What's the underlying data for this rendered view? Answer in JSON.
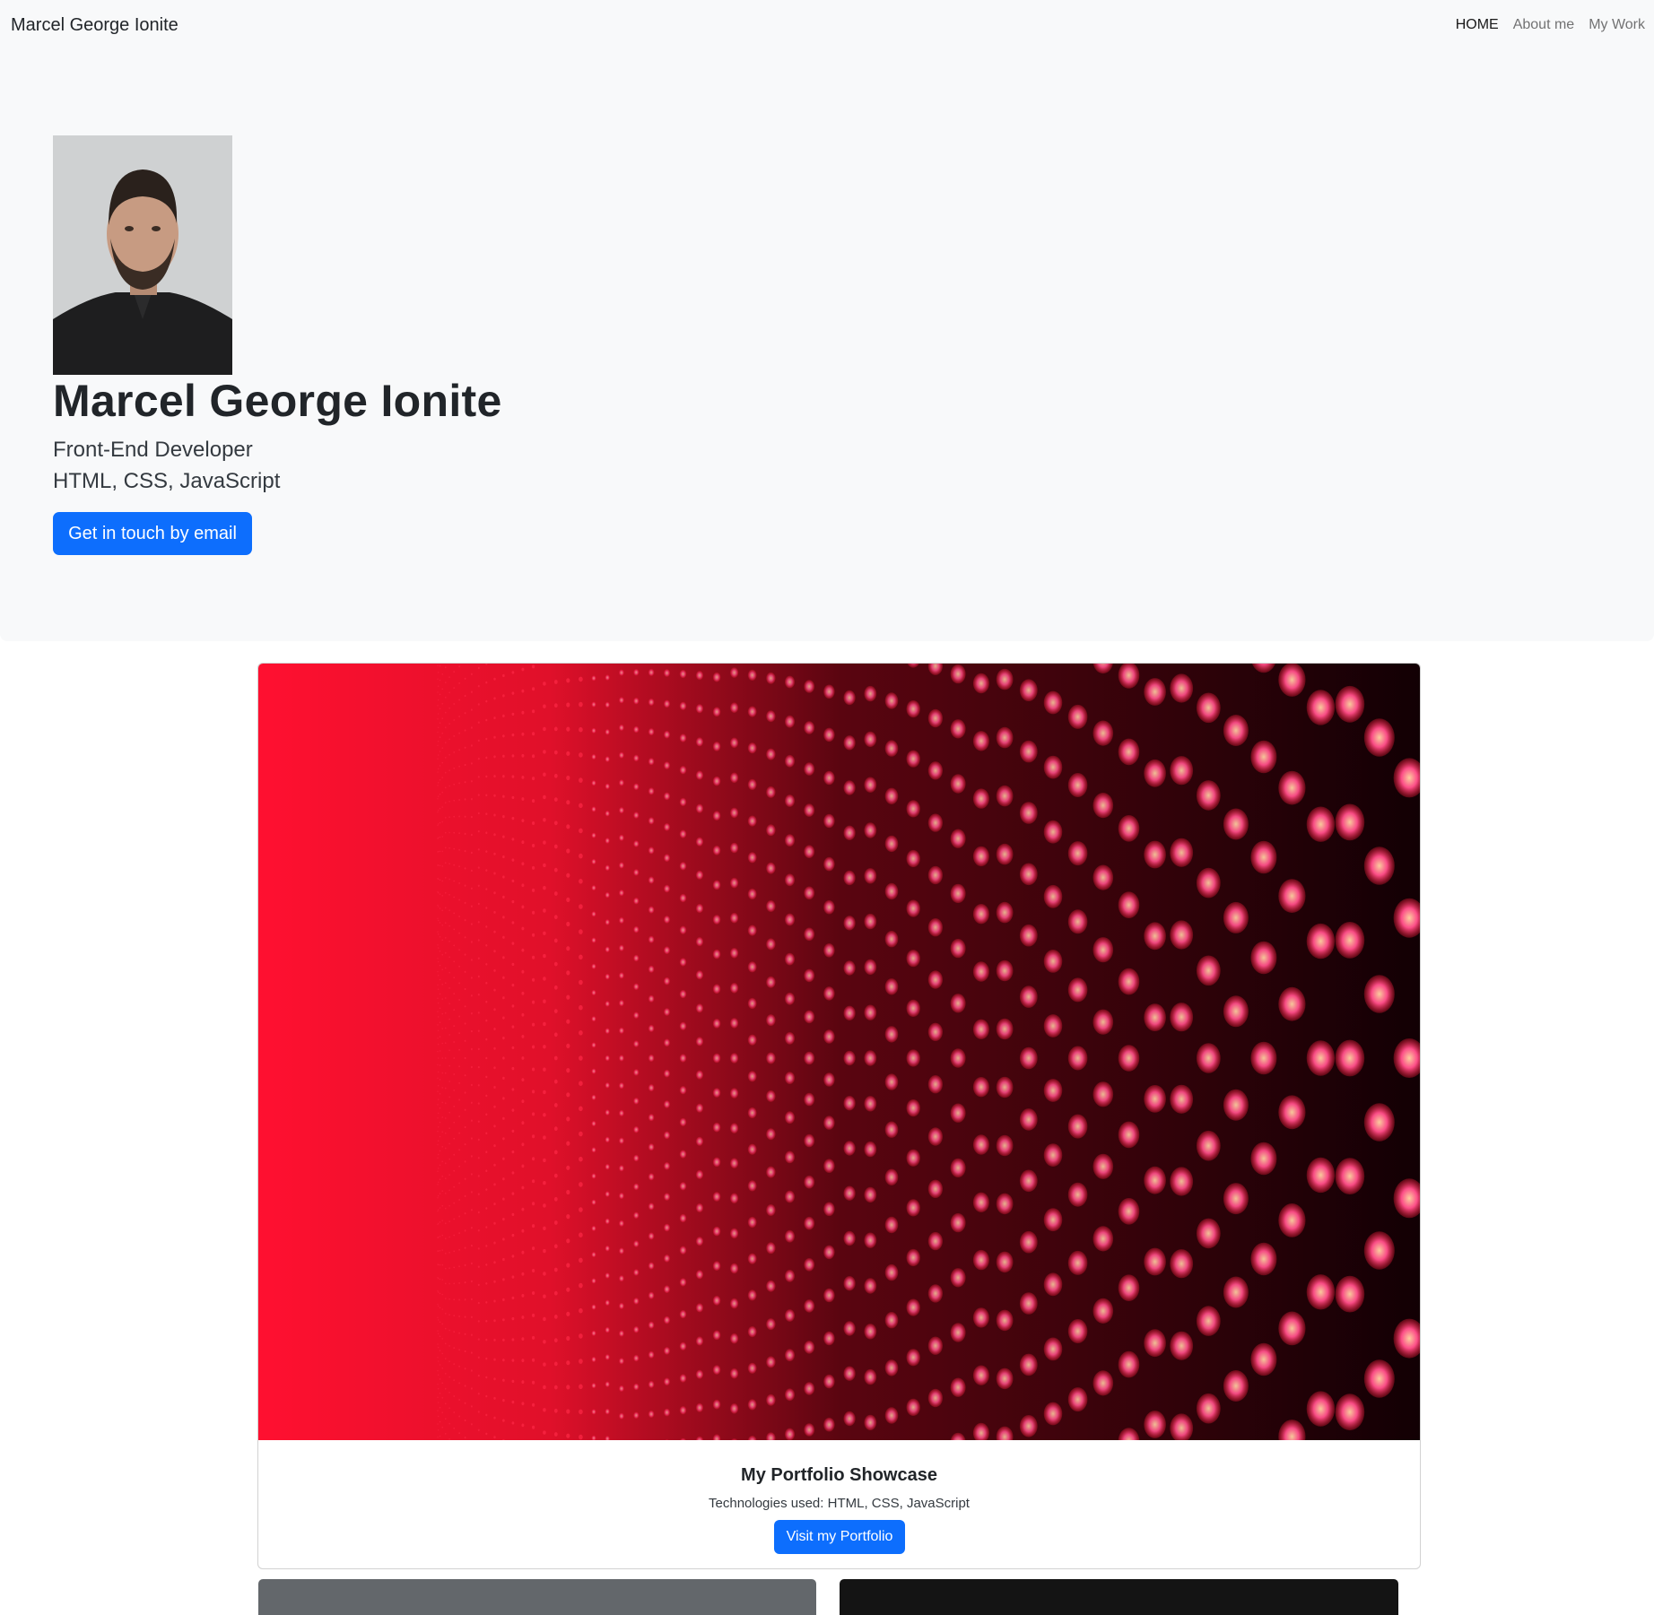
{
  "navbar": {
    "brand": "Marcel George Ionite",
    "links": [
      {
        "label": "HOME",
        "active": true
      },
      {
        "label": "About me",
        "active": false
      },
      {
        "label": "My Work",
        "active": false
      }
    ]
  },
  "hero": {
    "title": "Marcel George Ionite",
    "line1": "Front-End Developer",
    "line2": "HTML, CSS, JavaScript",
    "cta_label": "Get in touch by email"
  },
  "showcase": {
    "title": "My Portfolio Showcase",
    "text": "Technologies used: HTML, CSS, JavaScript",
    "button_label": "Visit my Portfolio"
  },
  "colors": {
    "primary": "#0d6efd",
    "hero_bg": "#f8f9fa",
    "led_red": "#ff1a3a",
    "led_pink": "#ff5fa8"
  }
}
